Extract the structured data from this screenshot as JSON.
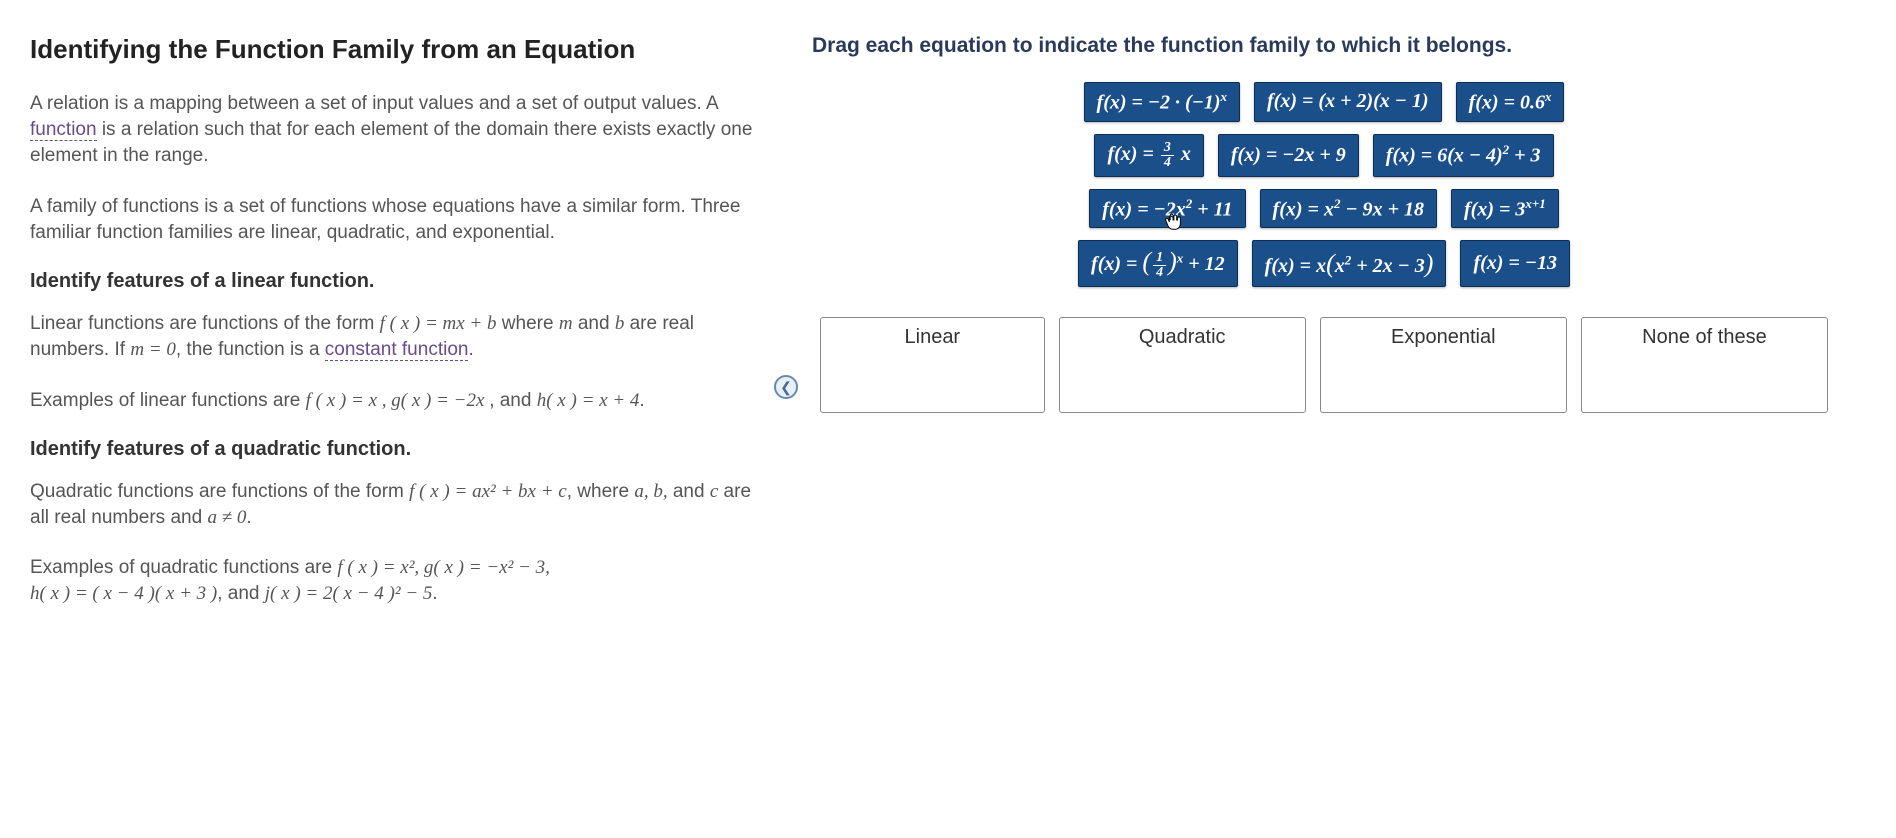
{
  "left": {
    "title": "Identifying the Function Family from an Equation",
    "p1_a": "A relation is a mapping between a set of input values and a set of output values. A ",
    "p1_link": "function",
    "p1_b": " is a relation such that for each element of the domain there exists exactly one element in the range.",
    "p2": "A family of functions is a set of functions whose equations have a similar form. Three familiar function families are linear, quadratic, and exponential.",
    "h2a": "Identify features of a linear function.",
    "p3_a": "Linear functions are functions of the form ",
    "p3_eq": "f ( x ) = mx + b",
    "p3_b": " where ",
    "p3_m": "m",
    "p3_c": " and ",
    "p3_bvar": "b",
    "p3_d": " are real numbers. If ",
    "p3_m0": "m = 0",
    "p3_e": ", the function is a ",
    "p3_link": "constant function",
    "p3_f": ".",
    "p4_a": "Examples of linear functions are ",
    "p4_eq": "f ( x ) = x , g( x ) = −2x ",
    "p4_b": ", and ",
    "p4_eq2": "h( x ) = x + 4",
    "p4_c": ".",
    "h2b": "Identify features of a quadratic function.",
    "p5_a": "Quadratic functions are functions of the form ",
    "p5_eq": "f ( x ) = ax² + bx + c",
    "p5_b": ", where ",
    "p5_vars": "a, b,",
    "p5_c": " and ",
    "p5_cvar": "c",
    "p5_d": " are all real numbers and ",
    "p5_ane0": "a ≠ 0",
    "p5_e": ".",
    "p6_a": "Examples of quadratic functions are ",
    "p6_eq1": "f ( x ) = x², g( x ) = −x² − 3,",
    "p6_eq2": "h( x ) = ( x − 4 )( x + 3 )",
    "p6_b": ", and ",
    "p6_eq3": "j( x ) = 2( x − 4 )² − 5",
    "p6_c": "."
  },
  "right": {
    "instruction": "Drag each equation to indicate the function family to which it belongs.",
    "chips": {
      "r1c1": "f(x) = −2 · (−1)ˣ",
      "r1c2": "f(x) = (x + 2)(x − 1)",
      "r1c3": "f(x) = 0.6ˣ",
      "r2c1_pre": "f(x) = ",
      "r2c1_num": "3",
      "r2c1_den": "4",
      "r2c1_post": " x",
      "r2c2": "f(x) = −2x + 9",
      "r2c3": "f(x) = 6(x − 4)² + 3",
      "r3c1": "f(x) = −2x² + 11",
      "r3c2": "f(x) = x² − 9x + 18",
      "r3c3": "f(x) = 3ˣ⁺¹",
      "r4c1_pre": "f(x) = ",
      "r4c1_num": "1",
      "r4c1_den": "4",
      "r4c1_post": " + 12",
      "r4c1_exp": "x",
      "r4c2": "f(x) = x(x² + 2x − 3)",
      "r4c3": "f(x) = −13"
    },
    "drops": {
      "linear": "Linear",
      "quadratic": "Quadratic",
      "exponential": "Exponential",
      "none": "None of these"
    }
  }
}
